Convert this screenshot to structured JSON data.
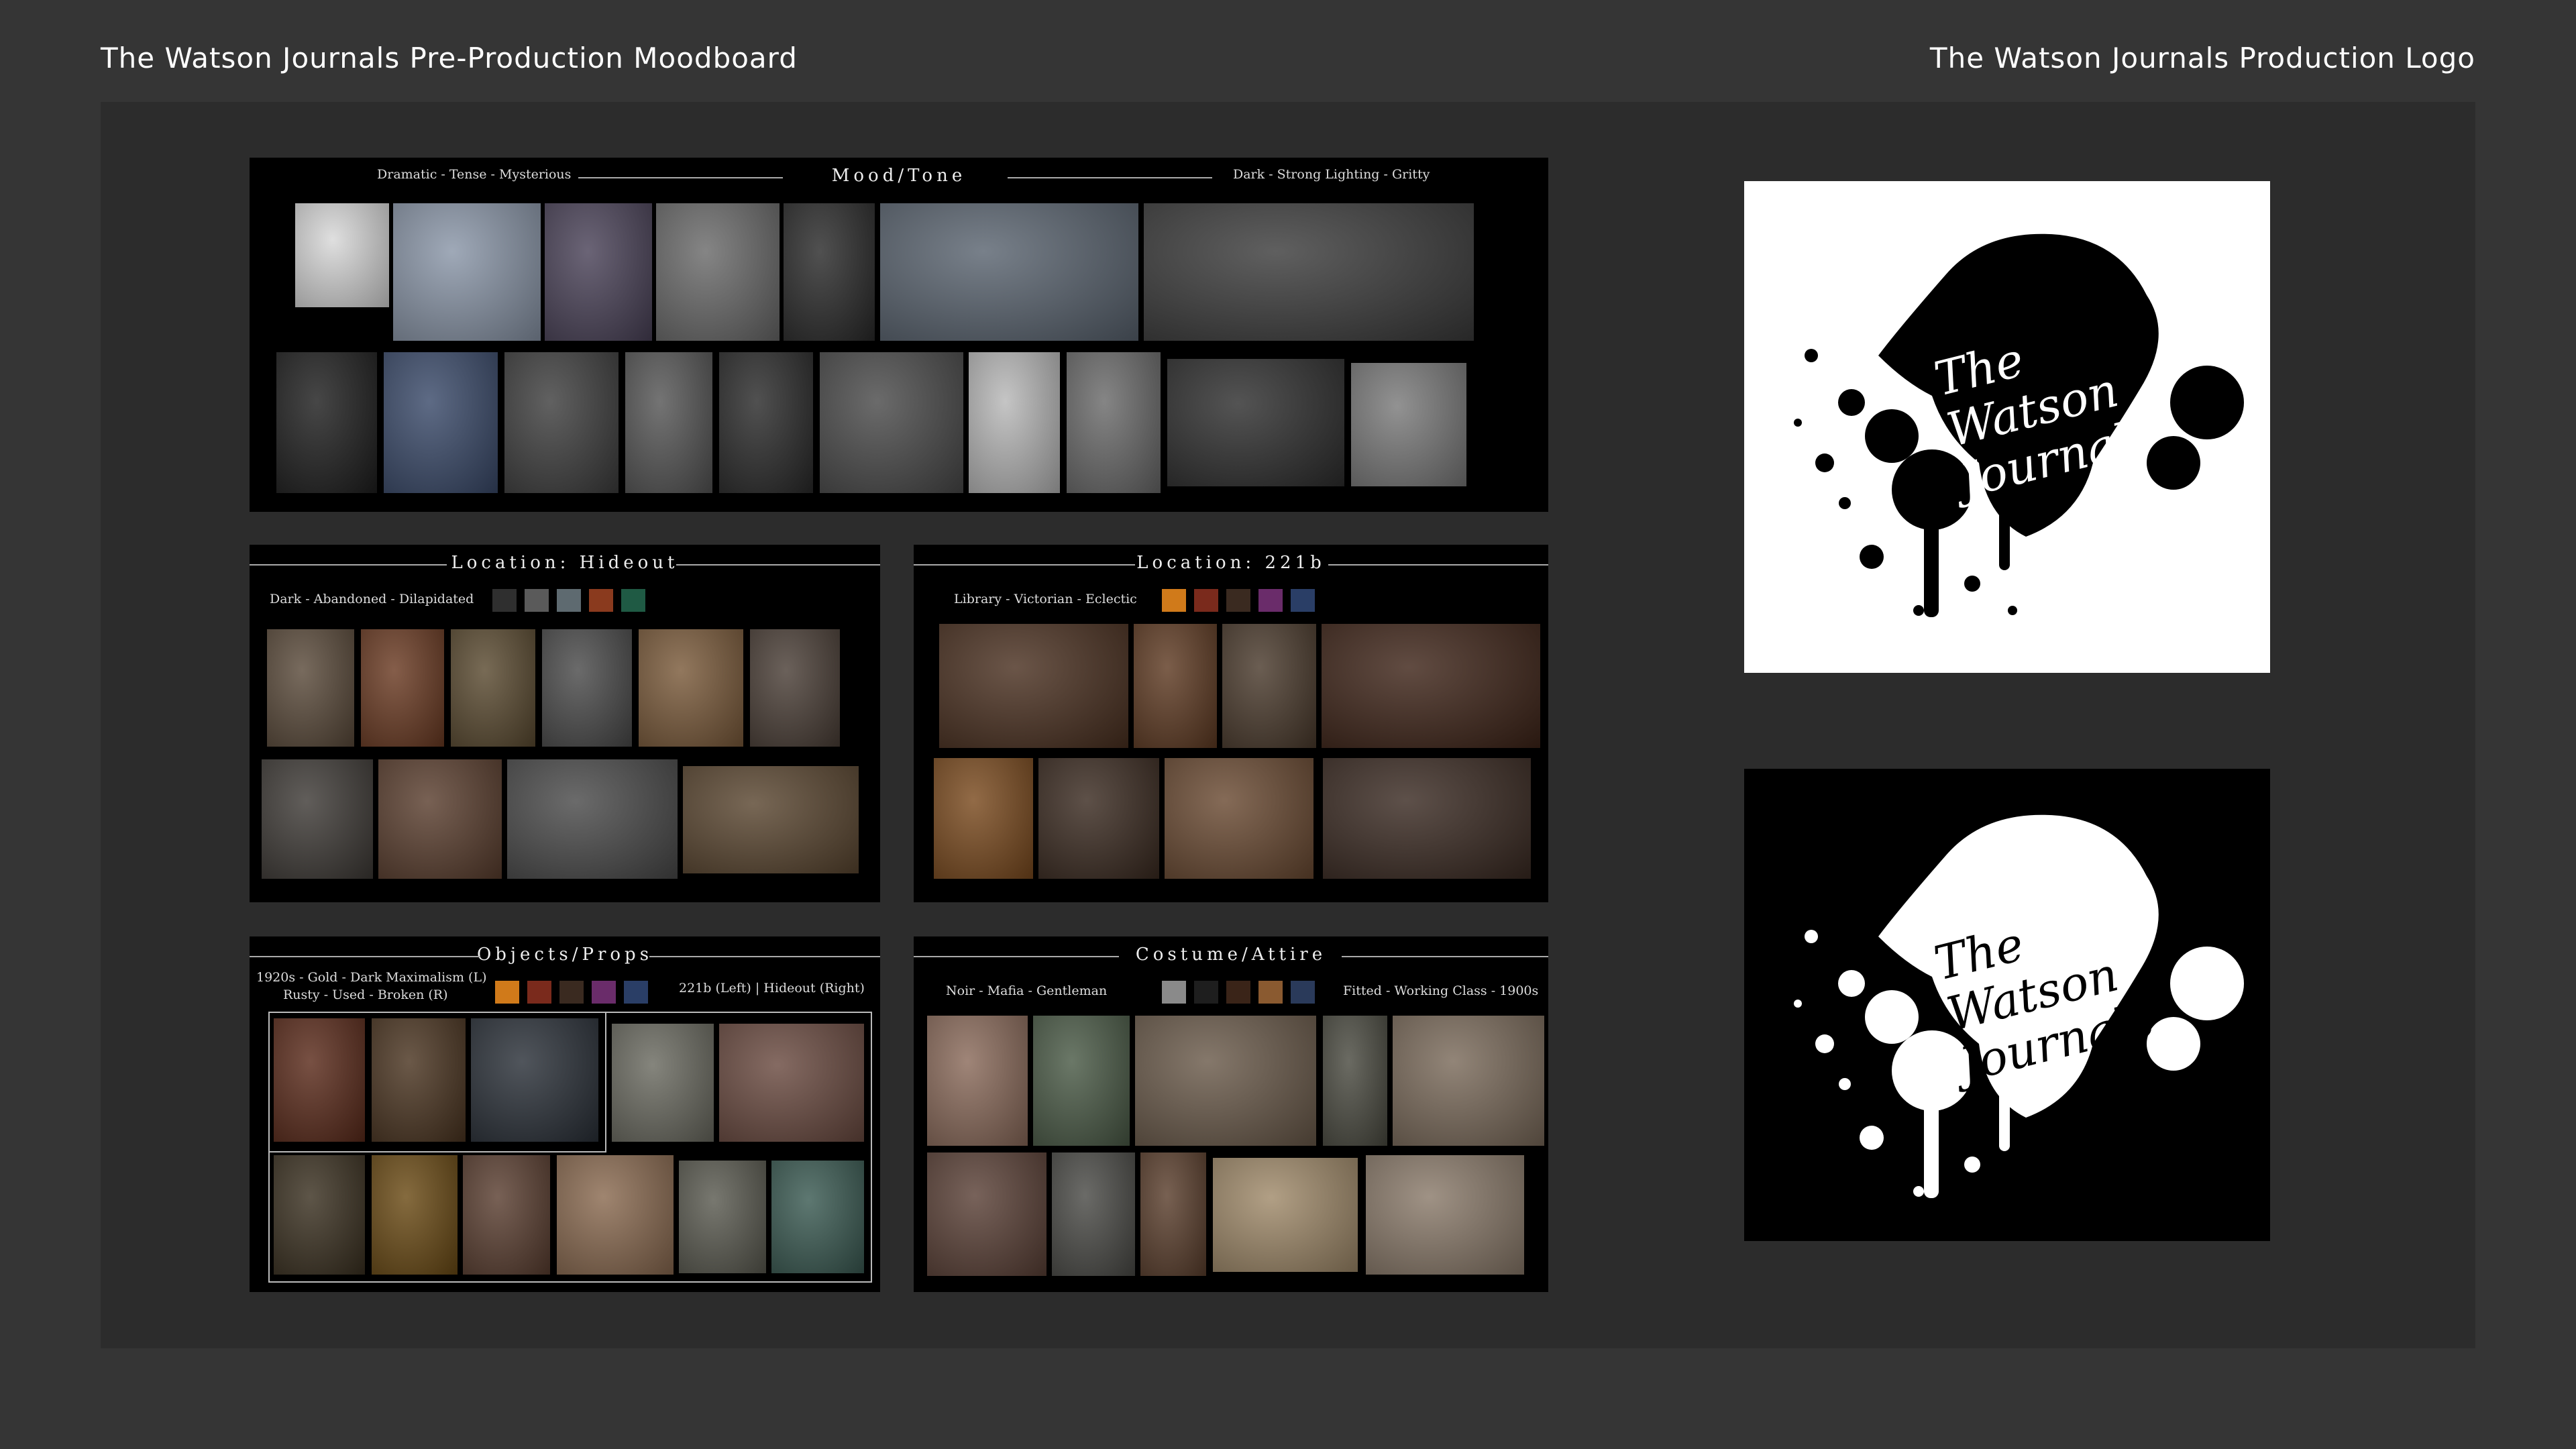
{
  "header": {
    "left_title": "The Watson Journals Pre-Production Moodboard",
    "right_title": "The Watson Journals Production Logo"
  },
  "panels": {
    "mood": {
      "heading": "Mood/Tone",
      "left_text": "Dramatic - Tense - Mysterious",
      "right_text": "Dark - Strong Lighting - Gritty"
    },
    "hideout": {
      "heading": "Location: Hideout",
      "subtitle": "Dark - Abandoned - Dilapidated",
      "swatches": [
        "#2f2f2f",
        "#5a5a5a",
        "#5e6a70",
        "#8a3a1e",
        "#1f5a44"
      ]
    },
    "bakerstreet": {
      "heading": "Location: 221b",
      "subtitle": "Library - Victorian - Eclectic",
      "swatches": [
        "#d07a1a",
        "#7a2a1c",
        "#3a2a20",
        "#6a2c6a",
        "#2a3e66"
      ]
    },
    "props": {
      "heading": "Objects/Props",
      "line1": "1920s - Gold - Dark Maximalism (L)",
      "line2": "Rusty - Used - Broken (R)",
      "right_text": "221b (Left) | Hideout (Right)",
      "swatches": [
        "#d07a1a",
        "#7a2a1c",
        "#3a2a20",
        "#6a2c6a",
        "#2a3e66"
      ]
    },
    "costume": {
      "heading": "Costume/Attire",
      "left_text": "Noir - Mafia - Gentleman",
      "right_text": "Fitted - Working Class - 1900s",
      "swatches": [
        "#8a8a8a",
        "#1e1e1e",
        "#3a2418",
        "#8a5a30",
        "#2a3a5a"
      ]
    }
  },
  "logo": {
    "line1": "The",
    "line2": "Watson",
    "line3": "Journals"
  }
}
